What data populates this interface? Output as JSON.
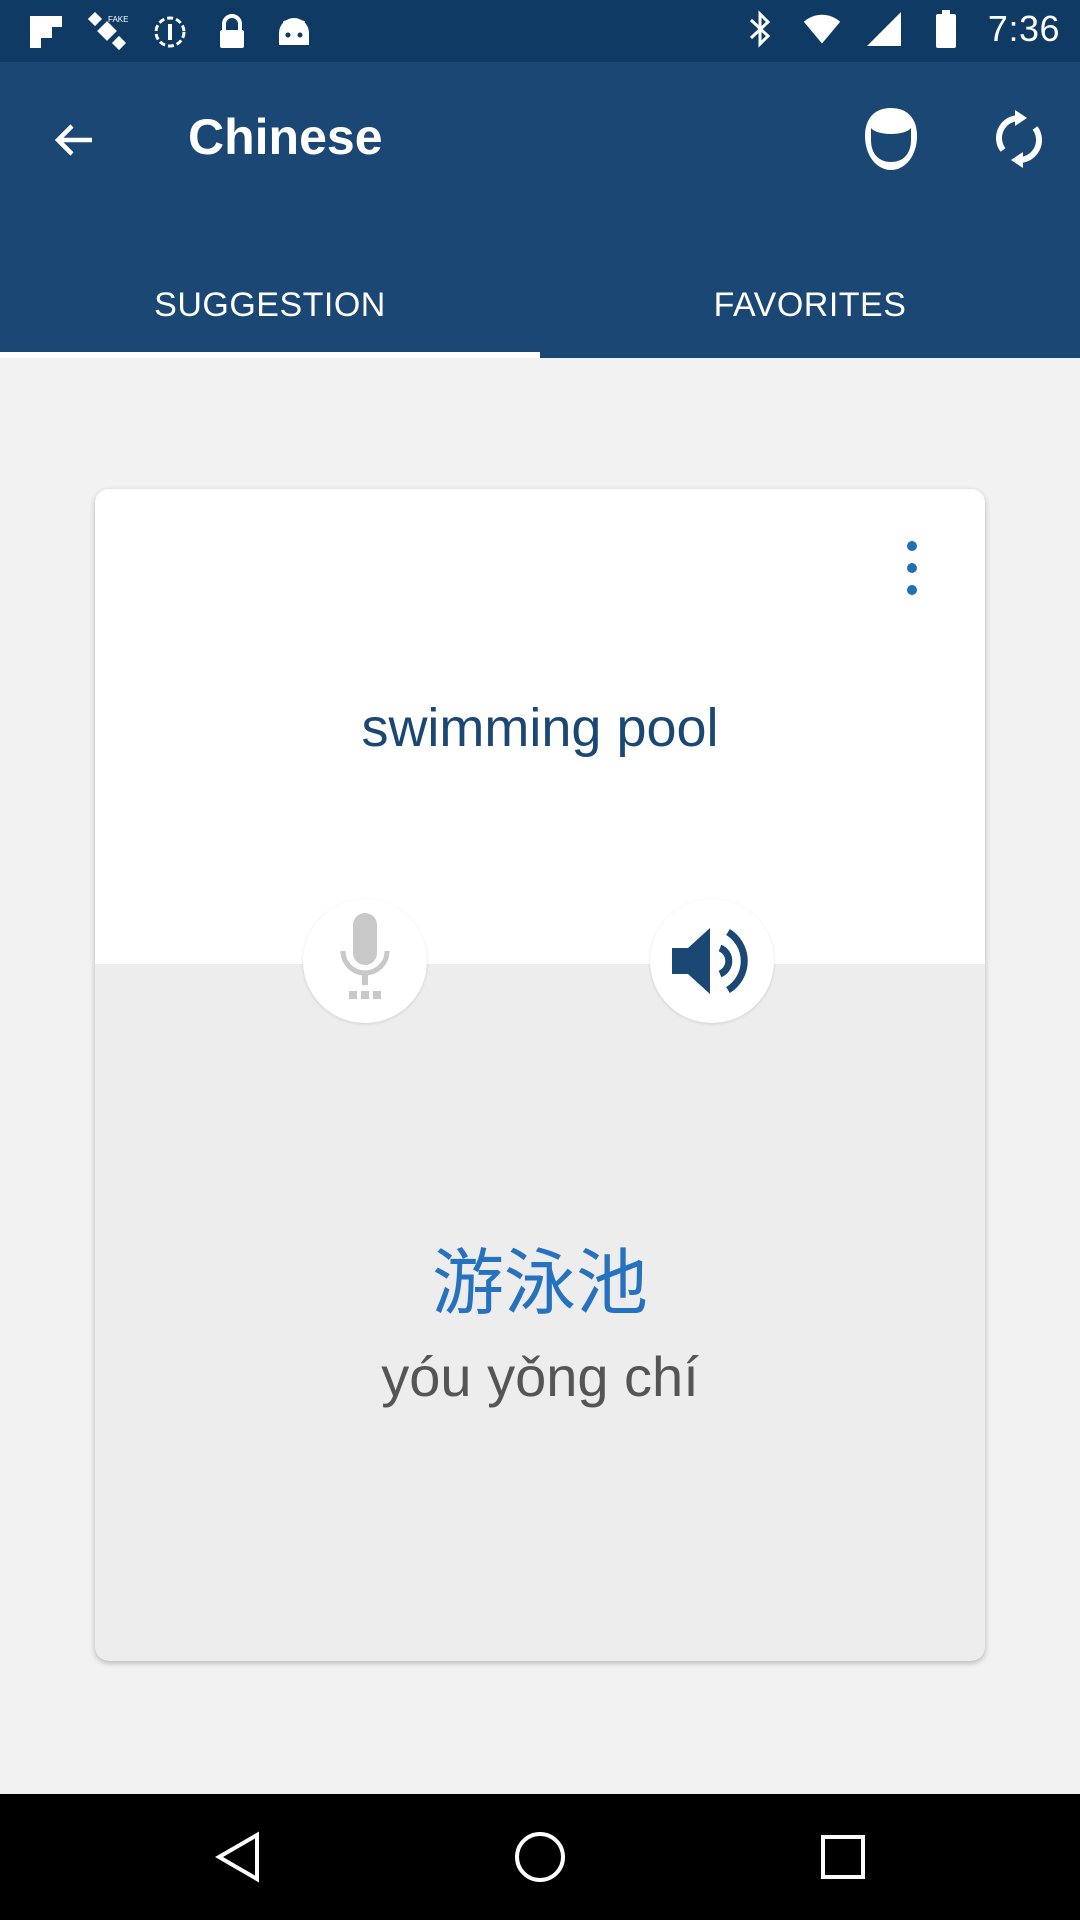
{
  "status_bar": {
    "time": "7:36",
    "left_icons": [
      "flipboard-icon",
      "fake-gps-icon",
      "data-saver-icon",
      "lock-icon",
      "android-icon"
    ],
    "right_icons": [
      "bluetooth-icon",
      "wifi-icon",
      "signal-icon",
      "battery-icon"
    ]
  },
  "app_bar": {
    "title": "Chinese",
    "color": "#1a4773"
  },
  "tabs": [
    {
      "label": "SUGGESTION",
      "active": true
    },
    {
      "label": "FAVORITES",
      "active": false
    }
  ],
  "card": {
    "english": "swimming pool",
    "chinese": "游泳池",
    "pinyin": "yóu yǒng chí"
  },
  "colors": {
    "accent": "#2672bf",
    "primary": "#1a4773",
    "status_bar": "#0f3a63"
  }
}
